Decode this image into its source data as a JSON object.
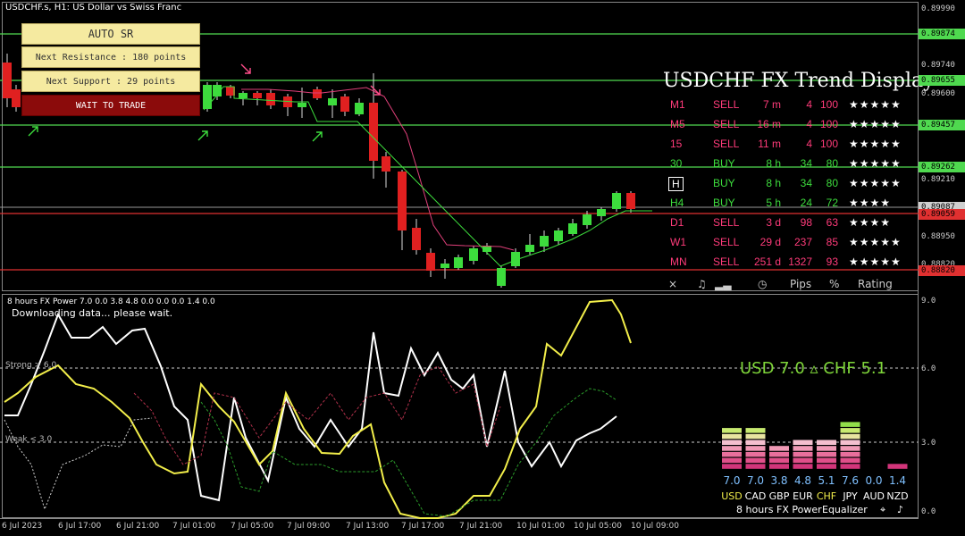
{
  "header": {
    "symbol_title": "USDCHF.s, H1:  US Dollar vs Swiss Franc"
  },
  "auto_sr": {
    "title": "AUTO SR",
    "resistance": "Next Resistance : 180 points",
    "support": "Next Support : 29 points",
    "action": "WAIT TO TRADE"
  },
  "trend_display": {
    "title": "USDCHF FX Trend Display",
    "rows": [
      {
        "tf": "M1",
        "dir": "SELL",
        "age": "7 m",
        "pips": "4",
        "pct": "100",
        "stars": "★★★★★",
        "color": "#ff3b7a"
      },
      {
        "tf": "M5",
        "dir": "SELL",
        "age": "16 m",
        "pips": "4",
        "pct": "100",
        "stars": "★★★★★",
        "color": "#ff3b7a"
      },
      {
        "tf": "15",
        "dir": "SELL",
        "age": "11 m",
        "pips": "4",
        "pct": "100",
        "stars": "★★★★★",
        "color": "#ff3b7a"
      },
      {
        "tf": "30",
        "dir": "BUY",
        "age": "8 h",
        "pips": "34",
        "pct": "80",
        "stars": "★★★★★",
        "color": "#3ddc3d"
      },
      {
        "tf": "H",
        "dir": "BUY",
        "age": "8 h",
        "pips": "34",
        "pct": "80",
        "stars": "★★★★★",
        "color": "#3ddc3d"
      },
      {
        "tf": "H4",
        "dir": "BUY",
        "age": "5 h",
        "pips": "24",
        "pct": "72",
        "stars": "★★★★",
        "color": "#3ddc3d"
      },
      {
        "tf": "D1",
        "dir": "SELL",
        "age": "3 d",
        "pips": "98",
        "pct": "63",
        "stars": "★★★★",
        "color": "#ff3b7a"
      },
      {
        "tf": "W1",
        "dir": "SELL",
        "age": "29 d",
        "pips": "237",
        "pct": "85",
        "stars": "★★★★★",
        "color": "#ff3b7a"
      },
      {
        "tf": "MN",
        "dir": "SELL",
        "age": "251 d",
        "pips": "1327",
        "pct": "93",
        "stars": "★★★★★",
        "color": "#ff3b7a"
      }
    ],
    "controls": {
      "close": "×",
      "music": "♫",
      "pips": "Pips",
      "pct": "%",
      "rating": "Rating"
    }
  },
  "price_axis": {
    "labels": [
      "0.89990",
      "0.89740",
      "0.89600",
      "0.89210",
      "0.88950",
      "0.88820"
    ],
    "green_boxes": [
      "0.89874",
      "0.89655",
      "0.89457",
      "0.89262"
    ],
    "grey_box": "0.89087",
    "red_boxes": [
      "0.89059",
      "0.88820"
    ]
  },
  "time_axis": [
    "6 Jul 2023",
    "6 Jul 17:00",
    "6 Jul 21:00",
    "7 Jul 01:00",
    "7 Jul 05:00",
    "7 Jul 09:00",
    "7 Jul 13:00",
    "7 Jul 17:00",
    "7 Jul 21:00",
    "10 Jul 01:00",
    "10 Jul 05:00",
    "10 Jul 09:00"
  ],
  "power": {
    "title": "8 hours FX Power 7.0 0.0 3.8 4.8 0.0 0.0 0.0 1.4 0.0",
    "message": "Downloading data... please wait.",
    "strong_label": "Strong > 6.0",
    "weak_label": "Weak < 3.0",
    "axis": [
      "9.0",
      "6.0",
      "3.0",
      "0.0"
    ],
    "pair_strength": "USD 7.0  ▵  CHF 5.1",
    "equalizer": {
      "currencies": [
        "USD",
        "CAD",
        "GBP",
        "EUR",
        "CHF",
        "JPY",
        "AUD",
        "NZD"
      ],
      "values": [
        "7.0",
        "7.0",
        "3.8",
        "4.8",
        "5.1",
        "7.6",
        "0.0",
        "1.4"
      ],
      "levels": [
        7.0,
        7.0,
        3.8,
        4.8,
        5.1,
        7.6,
        0.0,
        1.4
      ]
    },
    "footer": {
      "period": "8 hours",
      "name": "FX Power",
      "equalizer": "Equalizer"
    }
  }
}
